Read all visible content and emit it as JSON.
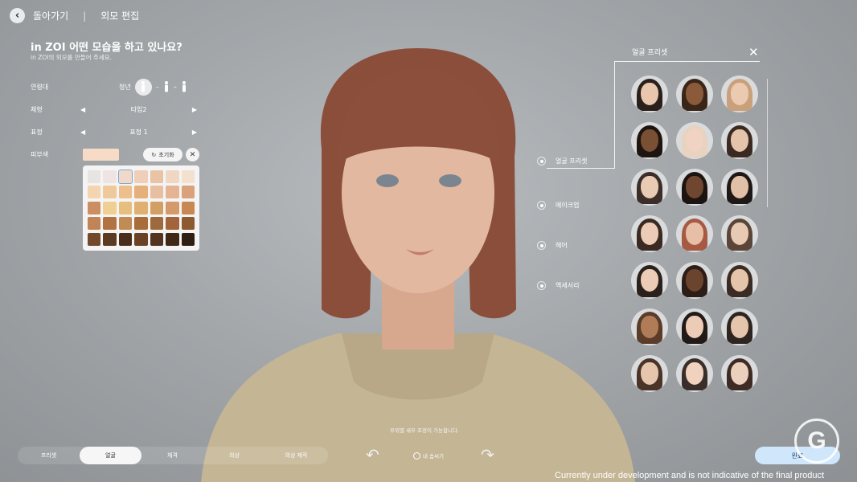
{
  "header": {
    "back_label": "돌아가기",
    "section_label": "외모 편집"
  },
  "intro": {
    "title": "in ZOI 어떤 모습을 하고 있나요?",
    "subtitle": "in ZOI의 외모를 만들어 주세요."
  },
  "settings": {
    "age": {
      "label": "연령대",
      "value": "청년"
    },
    "body": {
      "label": "체형",
      "value": "타입2"
    },
    "expression": {
      "label": "표정",
      "value": "표정 1"
    },
    "skin": {
      "label": "피부색",
      "reset_label": "초기화",
      "swatch_color": "#f6dcc6"
    }
  },
  "skin_palette": [
    "#e8e4e2",
    "#eee4e3",
    "#f1d9c9",
    "#efcfb8",
    "#e8c3a6",
    "#f0d7c2",
    "#f3e0cf",
    "#f4d5b0",
    "#f0c99a",
    "#ecbf8c",
    "#e6b07a",
    "#e8bfa0",
    "#e4b494",
    "#d9a27a",
    "#cc8d62",
    "#f0cf93",
    "#e8be7e",
    "#e0b070",
    "#d3a063",
    "#d49a6a",
    "#c88852",
    "#c28456",
    "#b27342",
    "#c08b55",
    "#a86d3b",
    "#9d6a3e",
    "#a2643a",
    "#8d5a32",
    "#73492b",
    "#5b3a22",
    "#4b2e1a",
    "#6a4327",
    "#523420",
    "#3f2816",
    "#2e1f12"
  ],
  "panel": {
    "title": "얼굴 프리셋",
    "categories": [
      "얼굴 프리셋",
      "메이크업",
      "헤어",
      "액세서리"
    ]
  },
  "faces": [
    {
      "skin": "#e9c7ae",
      "hair": "#2a1f1a"
    },
    {
      "skin": "#8a5a3a",
      "hair": "#3a2618"
    },
    {
      "skin": "#eccab2",
      "hair": "#c9a07a"
    },
    {
      "skin": "#7a5034",
      "hair": "#1e1410"
    },
    {
      "skin": "#f0d3c2",
      "hair": "#e8d2c0"
    },
    {
      "skin": "#e6c4ab",
      "hair": "#3a2a22"
    },
    {
      "skin": "#e9cbb4",
      "hair": "#3b2e28"
    },
    {
      "skin": "#6f4630",
      "hair": "#1c1410"
    },
    {
      "skin": "#e2c0a8",
      "hair": "#1e1816"
    },
    {
      "skin": "#ecccb6",
      "hair": "#3a2a22"
    },
    {
      "skin": "#e6bfa6",
      "hair": "#a65a44"
    },
    {
      "skin": "#e8c9b3",
      "hair": "#5a4538"
    },
    {
      "skin": "#ecccb6",
      "hair": "#2a201c"
    },
    {
      "skin": "#6b442e",
      "hair": "#2c1e16"
    },
    {
      "skin": "#e5c4ac",
      "hair": "#3a2c24"
    },
    {
      "skin": "#b07c58",
      "hair": "#5a3c28"
    },
    {
      "skin": "#ecccb6",
      "hair": "#221a16"
    },
    {
      "skin": "#e6c5ad",
      "hair": "#2e2420"
    },
    {
      "skin": "#e7c6ae",
      "hair": "#4a3428"
    },
    {
      "skin": "#f0d2bf",
      "hair": "#3a2e2a"
    },
    {
      "skin": "#ead0bd",
      "hair": "#3e2c24"
    }
  ],
  "bottom": {
    "note": "부위별 세부 조정이 가능합니다.",
    "tabs": [
      "프리셋",
      "얼굴",
      "체격",
      "의상",
      "의상 제작"
    ],
    "save_label": "내 솜씨기",
    "done_label": "완료",
    "logo_letter": "G",
    "disclaimer": "Currently under development and is not indicative of the final product"
  },
  "colors": {
    "accent": "#cfe6fb",
    "panel_bg": "#f4f4f4"
  }
}
